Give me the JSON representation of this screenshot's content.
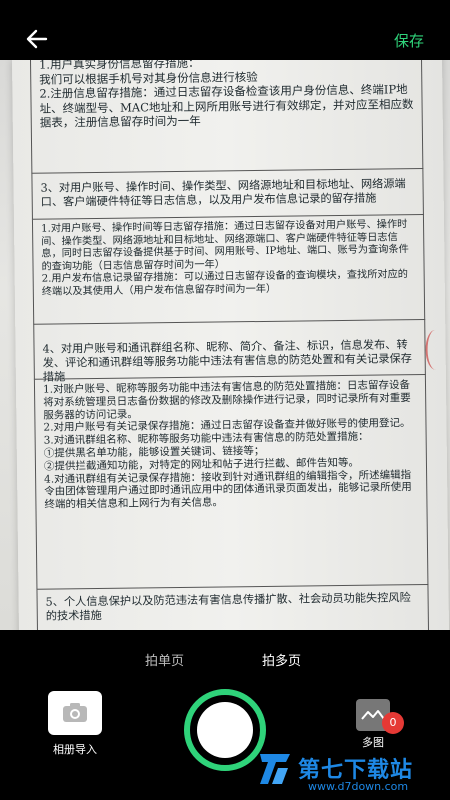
{
  "header": {
    "save_label": "保存"
  },
  "document": {
    "block1": "1.用户真实身份信息留存措施：\n我们可以根据手机号对其身份信息进行核验\n2.注册信息留存措施：通过日志留存设备检查该用户身份信息、终端IP地址、终端型号、MAC地址和上网所用账号进行有效绑定，并对应至相应数据表，注册信息留存时间为一年",
    "block2": "3、对用户账号、操作时间、操作类型、网络源地址和目标地址、网络源端口、客户端硬件特征等日志信息，以及用户发布信息记录的留存措施",
    "block3": "1.对用户账号、操作时间等日志留存措施：通过日志留存设备对用户账号、操作时间、操作类型、网络源地址和目标地址、网络源端口、客户端硬件特征等日志信息，同时日志留存设备提供基于时间、网用账号、IP地址、端口、账号为查询条件的查询功能（日志信息留存时间为一年）\n2.用户发布信息记录留存措施：可以通过日志留存设备的查询模块，查找所对应的终端以及其使用人（用户发布信息留存时间为一年）",
    "block4": "4、对用户账号和通讯群组名称、昵称、简介、备注、标识，信息发布、转发、评论和通讯群组等服务功能中违法有害信息的防范处置和有关记录保存措施",
    "block5": "1.对账户账号、昵称等服务功能中违法有害信息的防范处置措施：日志留存设备将对系统管理员日志备份数据的修改及删除操作进行记录，同时记录所有对重要服务器的访问记录。\n2.对用户账号有关记录保存措施：通过日志留存设备查并做好账号的使用登记。\n3.对通讯群组名称、昵称等服务功能中违法有害信息的防范处置措施：\n①提供黑名单功能，能够设置关键词、链接等；\n②提供拦截通知功能，对特定的网址和帖子进行拦截、邮件告知等。\n4.对通讯群组有关记录保存措施：接收到针对通讯群组的编辑指令，所述编辑指令由团体管理用户通过即时通讯应用中的团体通讯录页面发出，能够记录所使用终端的相关信息和上网行为有关信息。",
    "block6": "5、个人信息保护以及防范违法有害信息传播扩散、社会动员功能失控风险的技术措施"
  },
  "modes": {
    "single": "拍单页",
    "multi": "拍多页"
  },
  "album_label": "相册导入",
  "multi_label": "多图",
  "multi_count": "0",
  "brand": {
    "name": "第七下载站",
    "url": "www.d7down.com"
  },
  "colors": {
    "accent": "#2fd37a",
    "badge": "#e53935",
    "brand": "#1e88e5"
  }
}
